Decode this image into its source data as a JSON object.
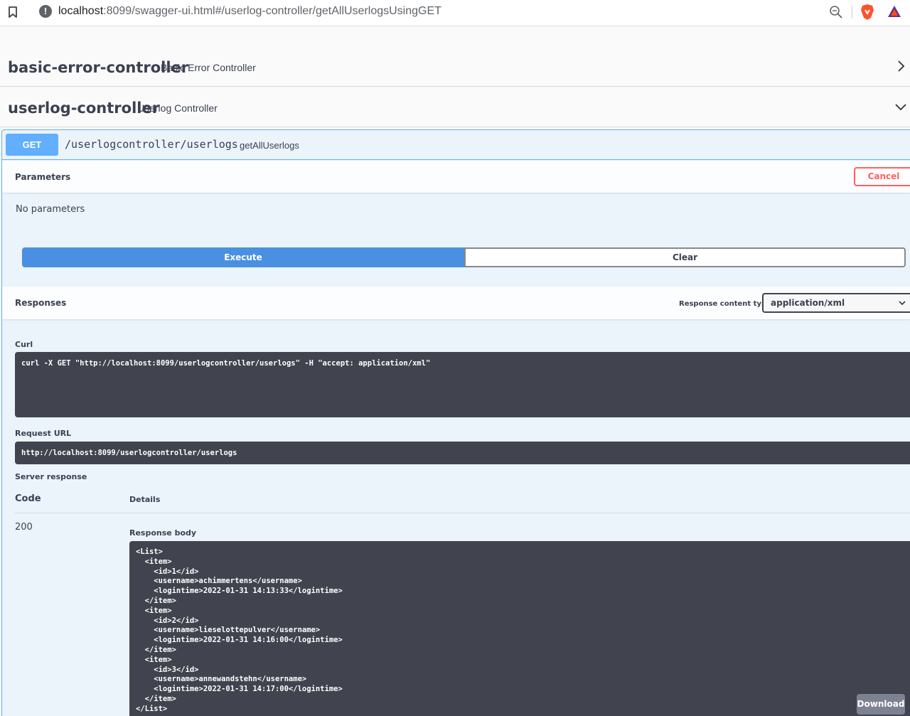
{
  "browser": {
    "url_host": "localhost",
    "url_rest": ":8099/swagger-ui.html#/userlog-controller/getAllUserlogsUsingGET"
  },
  "controllers": [
    {
      "name": "basic-error-controller",
      "description": "Basic Error Controller",
      "expanded": false
    },
    {
      "name": "userlog-controller",
      "description": "Userlog Controller",
      "expanded": true
    }
  ],
  "operation": {
    "method": "GET",
    "path": "/userlogcontroller/userlogs",
    "summary": "getAllUserlogs",
    "parameters_label": "Parameters",
    "cancel_label": "Cancel",
    "no_params": "No parameters",
    "execute_label": "Execute",
    "clear_label": "Clear",
    "responses_label": "Responses",
    "response_content_type_label": "Response content type",
    "response_content_type": "application/xml",
    "curl_label": "Curl",
    "curl": "curl -X GET \"http://localhost:8099/userlogcontroller/userlogs\" -H \"accept: application/xml\"",
    "request_url_label": "Request URL",
    "request_url": "http://localhost:8099/userlogcontroller/userlogs",
    "server_response_label": "Server response",
    "code_header": "Code",
    "details_header": "Details",
    "code": "200",
    "response_body_label": "Response body",
    "response_body": "<List>\n  <item>\n    <id>1</id>\n    <username>achimmertens</username>\n    <logintime>2022-01-31 14:13:33</logintime>\n  </item>\n  <item>\n    <id>2</id>\n    <username>lieselottepulver</username>\n    <logintime>2022-01-31 14:16:00</logintime>\n  </item>\n  <item>\n    <id>3</id>\n    <username>annewandstehn</username>\n    <logintime>2022-01-31 14:17:00</logintime>\n  </item>\n</List>",
    "download_label": "Download"
  },
  "colors": {
    "get": "#61affe",
    "execute": "#4990e2",
    "cancel": "#ff6060",
    "code_bg": "#41444e"
  }
}
